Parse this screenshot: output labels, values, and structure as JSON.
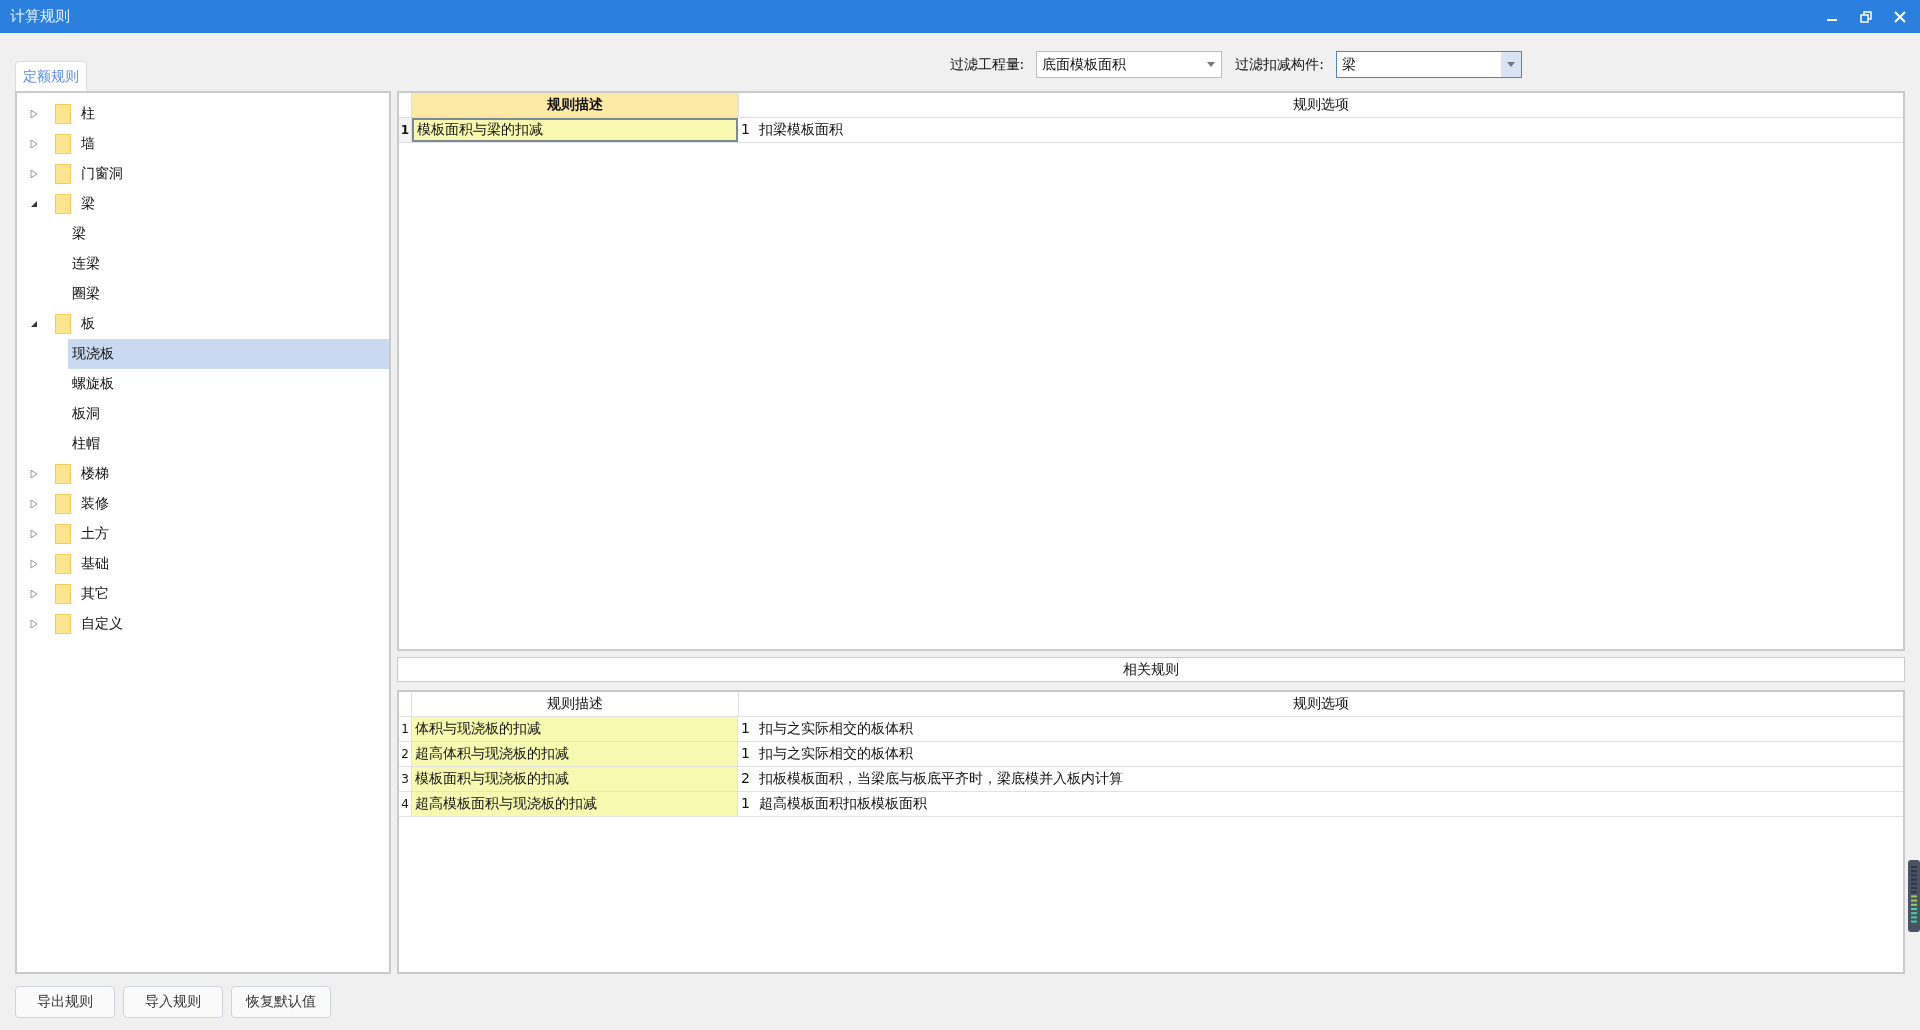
{
  "window": {
    "title": "计算规则"
  },
  "tabs": [
    {
      "label": "定额规则",
      "selected": true
    }
  ],
  "filters": [
    {
      "label": "过滤工程量:",
      "value": "底面模板面积",
      "focused": false
    },
    {
      "label": "过滤扣减构件:",
      "value": "梁",
      "focused": true
    }
  ],
  "tree": [
    {
      "label": "柱",
      "expanded": false,
      "selected": false
    },
    {
      "label": "墙",
      "expanded": false,
      "selected": false
    },
    {
      "label": "门窗洞",
      "expanded": false,
      "selected": false
    },
    {
      "label": "梁",
      "expanded": true,
      "selected": false,
      "children": [
        {
          "label": "梁",
          "selected": false
        },
        {
          "label": "连梁",
          "selected": false
        },
        {
          "label": "圈梁",
          "selected": false
        }
      ]
    },
    {
      "label": "板",
      "expanded": true,
      "selected": false,
      "children": [
        {
          "label": "现浇板",
          "selected": true
        },
        {
          "label": "螺旋板",
          "selected": false
        },
        {
          "label": "板洞",
          "selected": false
        },
        {
          "label": "柱帽",
          "selected": false
        }
      ]
    },
    {
      "label": "楼梯",
      "expanded": false,
      "selected": false
    },
    {
      "label": "装修",
      "expanded": false,
      "selected": false
    },
    {
      "label": "土方",
      "expanded": false,
      "selected": false
    },
    {
      "label": "基础",
      "expanded": false,
      "selected": false
    },
    {
      "label": "其它",
      "expanded": false,
      "selected": false
    },
    {
      "label": "自定义",
      "expanded": false,
      "selected": false
    }
  ],
  "rules_table": {
    "columns": [
      {
        "label": "规则描述",
        "selected": true
      },
      {
        "label": "规则选项",
        "selected": false
      }
    ],
    "rows": [
      {
        "index": "1",
        "description": "模板面积与梁的扣减",
        "option": "1  扣梁模板面积",
        "selected": true
      }
    ]
  },
  "related_rules": {
    "title": "相关规则",
    "columns": [
      {
        "label": "规则描述",
        "selected": false
      },
      {
        "label": "规则选项",
        "selected": false
      }
    ],
    "rows": [
      {
        "index": "1",
        "description": "体积与现浇板的扣减",
        "option": "1  扣与之实际相交的板体积",
        "selected": false
      },
      {
        "index": "2",
        "description": "超高体积与现浇板的扣减",
        "option": "1  扣与之实际相交的板体积",
        "selected": false
      },
      {
        "index": "3",
        "description": "模板面积与现浇板的扣减",
        "option": "2  扣板模板面积，当梁底与板底平齐时，梁底模并入板内计算",
        "selected": false
      },
      {
        "index": "4",
        "description": "超高模板面积与现浇板的扣减",
        "option": "1  超高模板面积扣板模板面积",
        "selected": false
      }
    ]
  },
  "buttons": [
    "导出规则",
    "导入规则",
    "恢复默认值"
  ]
}
